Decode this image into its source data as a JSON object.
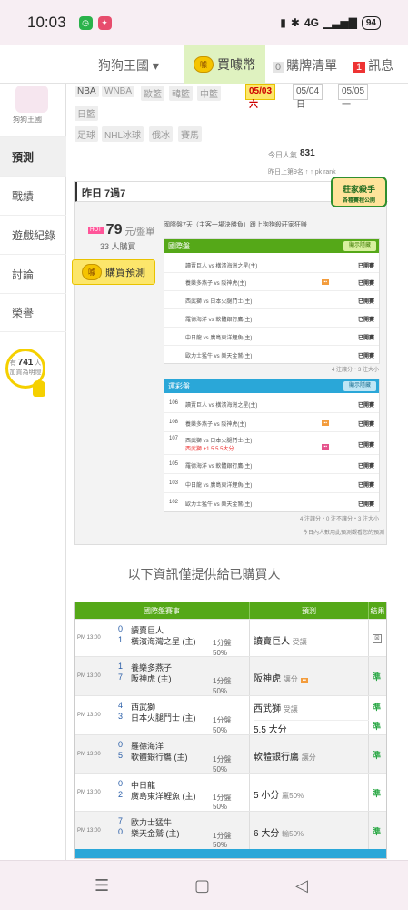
{
  "status": {
    "time": "10:03",
    "battery": "94",
    "signal": "4G"
  },
  "topnav": {
    "site": "狗狗王國",
    "buy_coins": "買噱幣",
    "coin_label": "噱",
    "cart_count": "0",
    "cart_label": "購牌清單",
    "msg_count": "1",
    "msg_label": "訊息"
  },
  "sidebar": {
    "avatar_label": "狗狗王國",
    "items": [
      "預測",
      "戰績",
      "遊戲紀錄",
      "討論",
      "榮譽"
    ],
    "helper_prefix": "有",
    "helper_count": "741",
    "helper_unit": "人",
    "helper_text": "加買為明燈"
  },
  "leagues": [
    "NBA",
    "WNBA",
    "歐籃",
    "韓籃",
    "中籃",
    "日籃",
    "足球",
    "NHL冰球",
    "俄冰",
    "賽馬"
  ],
  "dates": [
    "05/03 六",
    "05/04 日",
    "05/05 一"
  ],
  "popularity": {
    "label": "今日人氣",
    "value": "831",
    "rank": "昨日上第9名 ↑ ↑ pk rank"
  },
  "panel": {
    "title": "昨日 7過7",
    "stamp": "莊家殺手",
    "stamp_sub": "各種賽程公開",
    "price": "79",
    "price_unit": "元/盤單",
    "buyers": "33 人購買",
    "buy_button": "購買預測",
    "intro": "國際盤7天（主客一場決勝負）跟上狗狗殺莊家狂賺"
  },
  "intl_group": {
    "title": "國際盤",
    "toggle": "顯示隱藏",
    "rows": [
      {
        "teams": "讀賣巨人 vs 橫濱海灣之星(主)",
        "result": "已開賽"
      },
      {
        "teams": "養樂多燕子 vs 阪神虎(主)",
        "result": "已開賽"
      },
      {
        "teams": "西武獅 vs 日本火腿鬥士(主)",
        "result": "已開賽"
      },
      {
        "teams": "羅德海洋 vs 軟體銀行鷹(主)",
        "result": "已開賽"
      },
      {
        "teams": "中日龍 vs 廣島東洋鯉魚(主)",
        "result": "已開賽"
      },
      {
        "teams": "歐力士猛牛 vs 樂天金鷲(主)",
        "result": "已開賽"
      }
    ],
    "footer": "4 注讓分・3 注大小"
  },
  "sport_group": {
    "title": "運彩盤",
    "toggle": "顯示隱藏",
    "rows": [
      {
        "code": "106",
        "teams": "讀賣巨人 vs 橫濱海灣之星(主)",
        "result": "已開賽"
      },
      {
        "code": "108",
        "teams": "養樂多燕子 vs 阪神虎(主)",
        "result": "已開賽"
      },
      {
        "code": "107",
        "teams": "西武獅 vs 日本火腿鬥士(主)",
        "sub": "西武獅 +1.5 5.5大分",
        "result": "已開賽"
      },
      {
        "code": "105",
        "teams": "羅德海洋 vs 軟體銀行鷹(主)",
        "result": "已開賽"
      },
      {
        "code": "103",
        "teams": "中日龍 vs 廣島東洋鯉魚(主)",
        "result": "已開賽"
      },
      {
        "code": "102",
        "teams": "歐力士猛牛 vs 樂天金鷲(主)",
        "result": "已開賽"
      }
    ],
    "footer": "4 注讓分・0 注不讓分・3 注大小",
    "footer2": "今日內人數用此預測觀看您的預測"
  },
  "info_text": "以下資訊僅提供給已購買人",
  "picks": {
    "headers": [
      "國際盤賽事",
      "預測",
      "結果"
    ],
    "rows": [
      {
        "time": "PM 13:00",
        "s1": "0",
        "t1": "讀賣巨人",
        "s2": "1",
        "t2": "橫濱海灣之星 (主)",
        "line": "1分盤",
        "pct": "50%",
        "pick": "讀賣巨人",
        "pick_tag": "受讓",
        "result": "☒"
      },
      {
        "time": "PM 13:00",
        "s1": "1",
        "t1": "養樂多燕子",
        "s2": "7",
        "t2": "阪神虎 (主)",
        "line": "1分盤",
        "pct": "50%",
        "pick": "阪神虎",
        "pick_tag": "讓分",
        "result": "準"
      },
      {
        "time": "PM 13:00",
        "s1": "4",
        "t1": "西武獅",
        "s2": "3",
        "t2": "日本火腿鬥士 (主)",
        "line": "1分盤",
        "pct": "50%",
        "pick": "西武獅",
        "pick_tag": "受讓",
        "pick2": "5.5 大分",
        "result": "準",
        "result2": "準"
      },
      {
        "time": "PM 13:00",
        "s1": "0",
        "t1": "羅德海洋",
        "s2": "5",
        "t2": "軟體銀行鷹 (主)",
        "line": "1分盤",
        "pct": "50%",
        "pick": "軟體銀行鷹",
        "pick_tag": "讓分",
        "result": "準"
      },
      {
        "time": "PM 13:00",
        "s1": "0",
        "t1": "中日龍",
        "s2": "2",
        "t2": "廣島東洋鯉魚 (主)",
        "line": "1分盤",
        "pct": "50%",
        "pick": "5 小分",
        "pick_tag": "贏50%",
        "result": "準"
      },
      {
        "time": "PM 13:00",
        "s1": "7",
        "t1": "歐力士猛牛",
        "s2": "0",
        "t2": "樂天金鷲 (主)",
        "line": "1分盤",
        "pct": "50%",
        "pick": "6 大分",
        "pick_tag": "輸50%",
        "result": "準"
      }
    ]
  },
  "navbar": {
    "menu": "☰",
    "home": "▢",
    "back": "◁"
  }
}
